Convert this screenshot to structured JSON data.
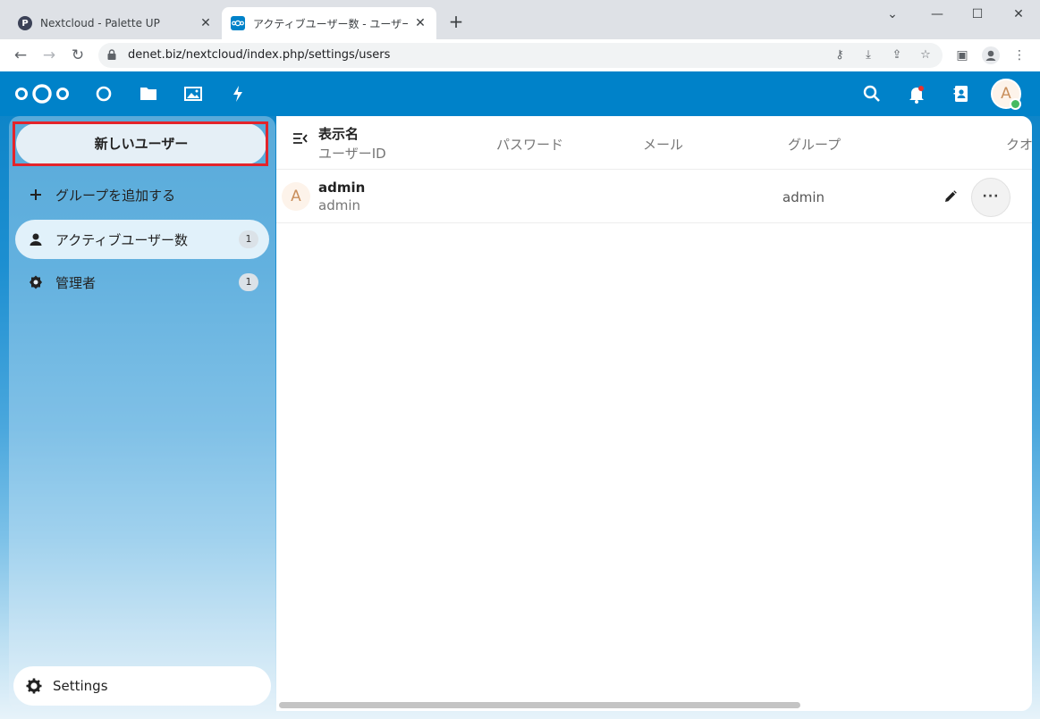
{
  "browser": {
    "tabs": [
      {
        "title": "Nextcloud - Palette UP",
        "favicon": "P",
        "active": false
      },
      {
        "title": "アクティブユーザー数 - ユーザー - ユーザ",
        "favicon": "oOo",
        "active": true
      }
    ],
    "new_tab_icon": "plus-icon",
    "url": "denet.biz/nextcloud/index.php/settings/users",
    "window_controls": [
      "chevron-down-icon",
      "minimize-icon",
      "maximize-icon",
      "close-icon"
    ]
  },
  "header": {
    "brand_color": "#0082c9",
    "apps": [
      "dashboard-icon",
      "files-icon",
      "photos-icon",
      "activity-icon"
    ],
    "right_icons": [
      "search-icon",
      "notifications-icon",
      "contacts-icon"
    ],
    "avatar_letter": "A"
  },
  "sidebar": {
    "new_user_label": "新しいユーザー",
    "items": [
      {
        "label": "グループを追加する",
        "icon": "plus-icon",
        "count": null
      },
      {
        "label": "アクティブユーザー数",
        "icon": "user-icon",
        "count": "1"
      },
      {
        "label": "管理者",
        "icon": "shield-icon",
        "count": "1"
      }
    ],
    "settings_label": "Settings"
  },
  "table": {
    "headers": {
      "display_name": "表示名",
      "user_id": "ユーザーID",
      "password": "パスワード",
      "email": "メール",
      "groups": "グループ",
      "quota": "クオ"
    },
    "rows": [
      {
        "avatar": "A",
        "display_name": "admin",
        "user_id": "admin",
        "groups": "admin"
      }
    ]
  }
}
